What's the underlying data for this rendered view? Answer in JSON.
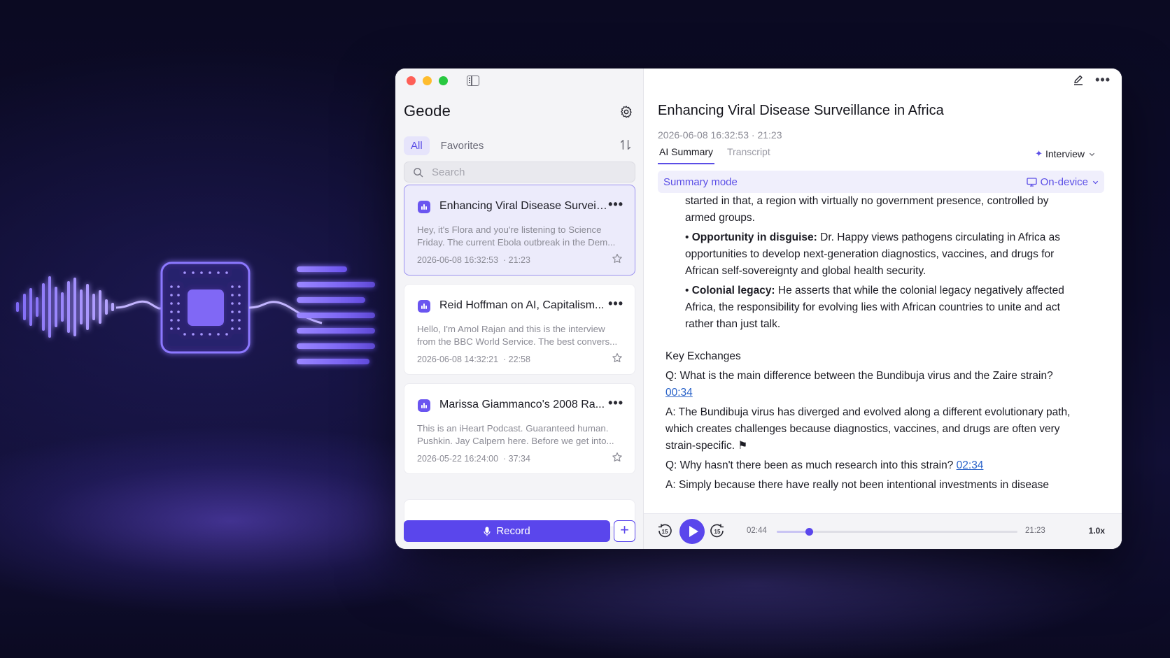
{
  "sidebar": {
    "app_title": "Geode",
    "filters": [
      "All",
      "Favorites"
    ],
    "active_filter": "All",
    "search_placeholder": "Search",
    "recordings": [
      {
        "title": "Enhancing Viral Disease Surveil...",
        "preview_line1": "Hey, it's Flora and you're listening to Science",
        "preview_line2": "Friday. The current Ebola outbreak in the Dem...",
        "date": "2026-06-08 16:32:53",
        "duration": "· 21:23",
        "selected": true
      },
      {
        "title": "Reid Hoffman on AI, Capitalism...",
        "preview_line1": "Hello, I'm Amol Rajan and this is the interview",
        "preview_line2": "from the BBC World Service. The best convers...",
        "date": "2026-06-08 14:32:21",
        "duration": "· 22:58",
        "selected": false
      },
      {
        "title": "Marissa Giammanco's 2008 Ra...",
        "preview_line1": "This is an iHeart Podcast. Guaranteed human.",
        "preview_line2": "Pushkin. Jay Calpern here. Before we get into...",
        "date": "2026-05-22 16:24:00",
        "duration": "· 37:34",
        "selected": false
      }
    ],
    "record_label": "Record",
    "add_label": "+"
  },
  "main": {
    "title": "Enhancing Viral Disease Surveillance in Africa",
    "meta": "2026-06-08 16:32:53  ·  21:23",
    "tabs": [
      "AI Summary",
      "Transcript"
    ],
    "active_tab": "AI Summary",
    "template": "Interview",
    "summary_mode_label": "Summary mode",
    "processing": "On-device",
    "content": {
      "cut_line": "started in that, a region with virtually no government presence, controlled by",
      "cut_line2": "armed groups.",
      "bullet1_bold": "Opportunity in disguise:",
      "bullet1_text": " Dr. Happy views pathogens circulating in Africa as",
      "bullet1_line2": "opportunities to develop next-generation diagnostics, vaccines, and drugs for",
      "bullet1_line3": "African self-sovereignty and global health security.",
      "bullet2_bold": "Colonial legacy:",
      "bullet2_text": " He asserts that while the colonial legacy negatively affected",
      "bullet2_line2": "Africa, the responsibility for evolving lies with African countries to unite and act",
      "bullet2_line3": "rather than just talk.",
      "section_heading": "Key Exchanges",
      "q1": "Q: What is the main difference between the Bundibuja virus and the Zaire strain?",
      "q1_time": "00:34",
      "a1_line1": "A: The Bundibuja virus has diverged and evolved along a different evolutionary path,",
      "a1_line2": "which creates challenges because diagnostics, vaccines, and drugs are often very",
      "a1_line3": "strain-specific. ⚑",
      "q2": "Q: Why hasn't there been as much research into this strain? ",
      "q2_time": "02:34",
      "a2_line1": "A: Simply because there have really not been intentional investments in disease"
    }
  },
  "player": {
    "current_time": "02:44",
    "total_time": "21:23",
    "progress": 0.135,
    "speed": "1.0x",
    "skip_back": "15",
    "skip_forward": "15"
  },
  "colors": {
    "accent": "#5a46ec",
    "link": "#2a63c9",
    "background": "#0d0c2c"
  }
}
